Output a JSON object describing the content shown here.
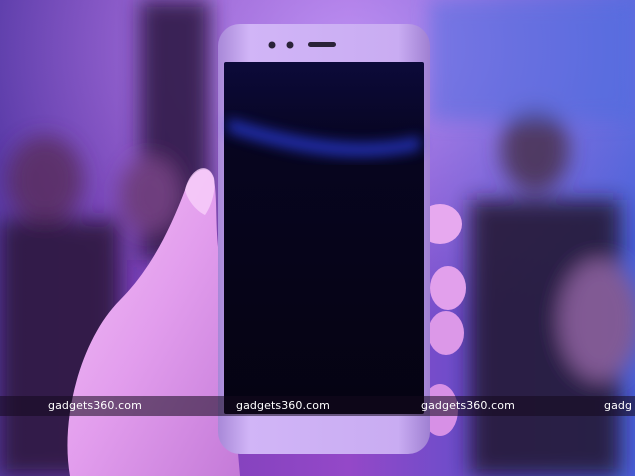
{
  "photo": {
    "subject": "smartphone-held-in-hand",
    "colors": {
      "background_purple": "#7a3fb0",
      "background_blue": "#3a5ad0",
      "phone_frame": "#c8a6f0",
      "screen": "#0a0620",
      "skin": "#e7a9ef"
    }
  },
  "watermark": {
    "text_1": "gadgets360.com",
    "text_2": "gadgets360.com",
    "text_3": "gadgets360.com",
    "text_4": "gadg"
  }
}
